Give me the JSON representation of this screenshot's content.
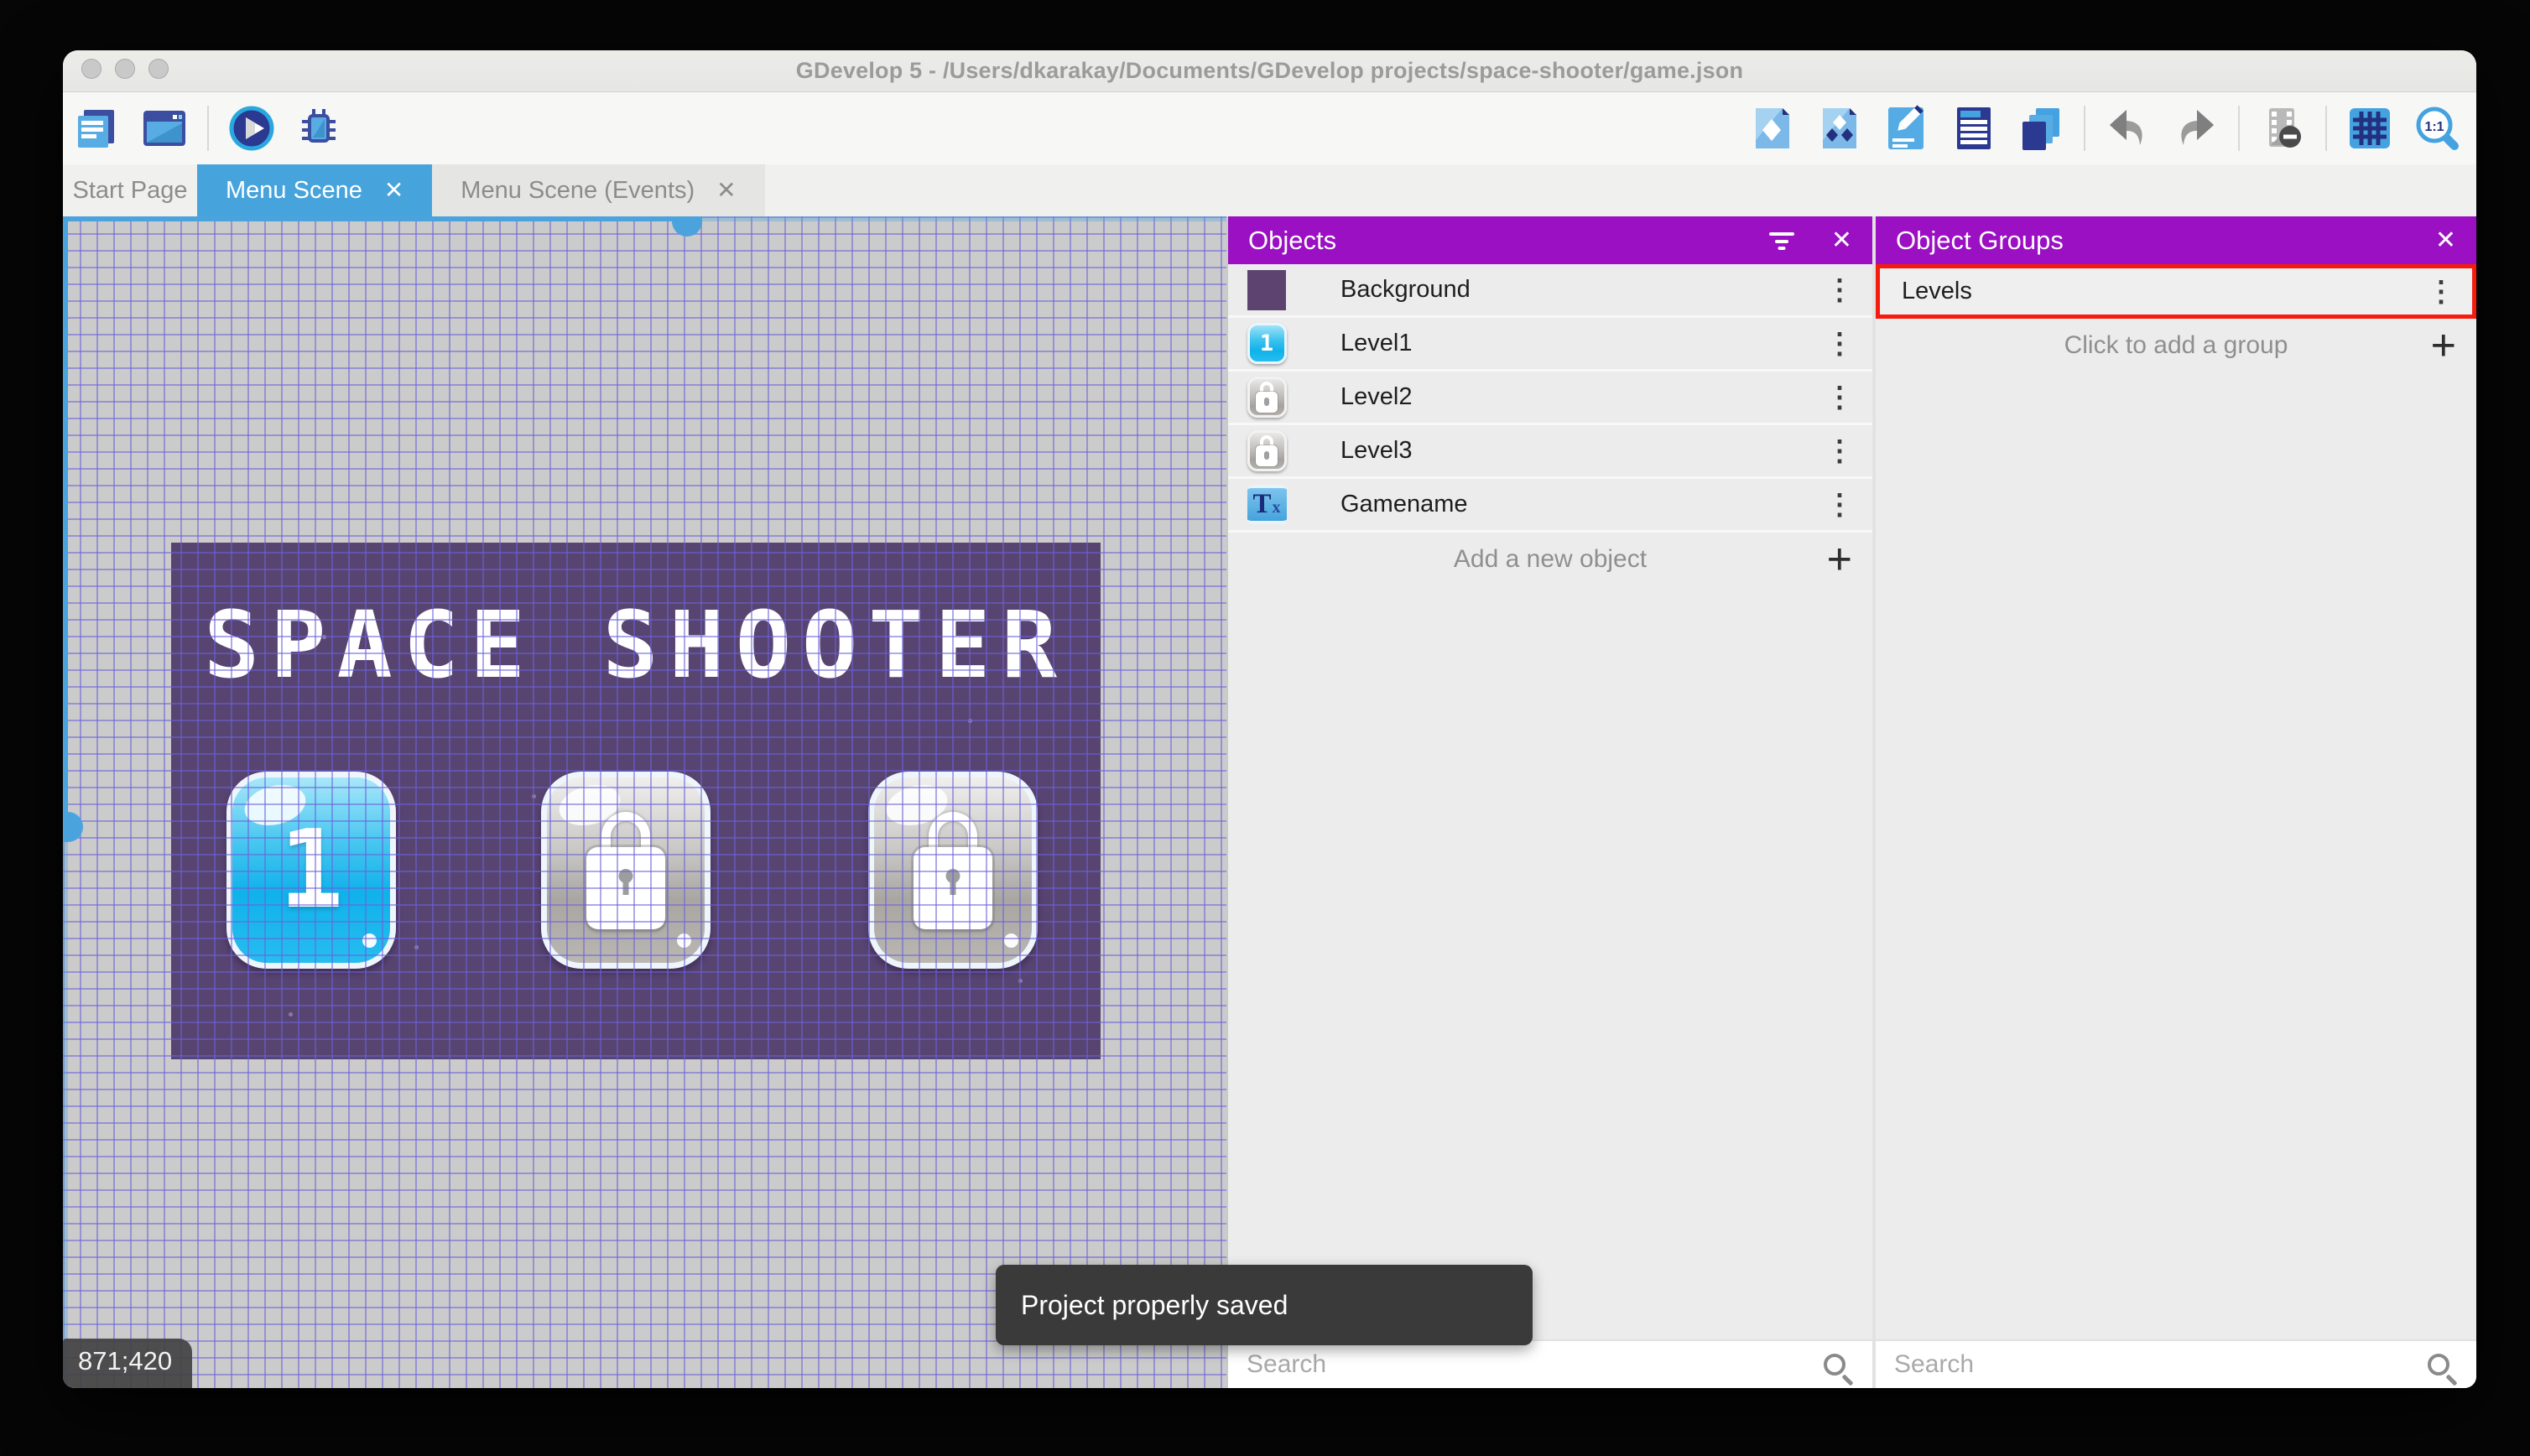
{
  "window": {
    "title": "GDevelop 5 - /Users/dkarakay/Documents/GDevelop projects/space-shooter/game.json"
  },
  "toolbar": {
    "left_icons": [
      "project-manager-icon",
      "scene-window-icon",
      "play-preview-icon",
      "debug-bug-icon"
    ],
    "right_icons": [
      "objects-editor-icon",
      "object-groups-editor-icon",
      "properties-pencil-icon",
      "instances-list-icon",
      "layers-icon",
      "undo-icon",
      "redo-icon",
      "filmstrip-minus-icon",
      "grid-icon",
      "zoom-1-1-icon"
    ],
    "zoom_label": "1:1"
  },
  "tabs": [
    {
      "label": "Start Page",
      "active": false
    },
    {
      "label": "Menu Scene",
      "active": true
    },
    {
      "label": "Menu Scene (Events)",
      "active": false
    }
  ],
  "canvas": {
    "scene_title": "SPACE SHOOTER",
    "coordinates": "871;420",
    "toast": "Project properly saved",
    "level_buttons": [
      {
        "label": "1",
        "state": "unlocked"
      },
      {
        "label": "",
        "state": "locked"
      },
      {
        "label": "",
        "state": "locked"
      }
    ]
  },
  "objects_panel": {
    "title": "Objects",
    "items": [
      {
        "label": "Background",
        "thumb": "purple-swatch"
      },
      {
        "label": "Level1",
        "thumb": "blue-level-button"
      },
      {
        "label": "Level2",
        "thumb": "gray-lock-button"
      },
      {
        "label": "Level3",
        "thumb": "gray-lock-button"
      },
      {
        "label": "Gamename",
        "thumb": "text-object"
      }
    ],
    "add_label": "Add a new object",
    "search_placeholder": "Search"
  },
  "object_groups_panel": {
    "title": "Object Groups",
    "groups": [
      {
        "label": "Levels",
        "highlighted": true
      }
    ],
    "add_label": "Click to add a group",
    "search_placeholder": "Search"
  },
  "icons": {
    "close": "✕",
    "kebab": "⋮",
    "plus": "+"
  },
  "colors": {
    "accent_blue": "#47a3dc",
    "panel_header_purple": "#9a10c2",
    "highlight_red": "#f61b0d",
    "scene_purple": "#584471",
    "toast_bg": "#3a3a3a"
  }
}
